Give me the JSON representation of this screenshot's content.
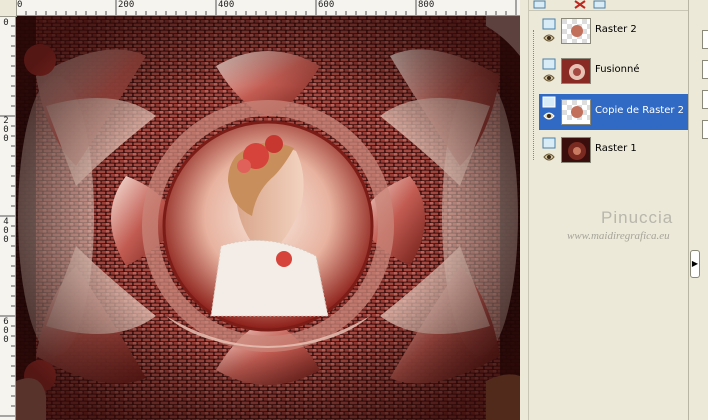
{
  "rulers": {
    "top_labels": [
      "0",
      "200",
      "400",
      "600",
      "800"
    ],
    "left_labels": [
      "0",
      "200",
      "400",
      "600"
    ]
  },
  "canvas": {
    "image": "tiled-kaleidoscope-artwork-woman-with-roses",
    "colors": {
      "brick": "#8a2a24",
      "dark": "#3a0e0c",
      "light": "#f1d9cf"
    }
  },
  "layers": {
    "items": [
      {
        "name": "Raster 2",
        "selected": false,
        "thumb": "transparent-with-figure"
      },
      {
        "name": "Fusionné",
        "selected": false,
        "thumb": "kaleidoscope"
      },
      {
        "name": "Copie de Raster 2",
        "selected": true,
        "thumb": "transparent-with-figure"
      },
      {
        "name": "Raster 1",
        "selected": false,
        "thumb": "dark-pattern"
      }
    ],
    "selected_color": "#316ac5"
  },
  "watermark": {
    "title": "Pinuccia",
    "url": "www.maidiregrafica.eu"
  },
  "icons": {
    "toolbar": [
      "new-layer-icon",
      "delete-layer-icon",
      "layer-options-icon"
    ],
    "row": [
      "layer-type-icon",
      "visibility-eye-icon"
    ]
  }
}
